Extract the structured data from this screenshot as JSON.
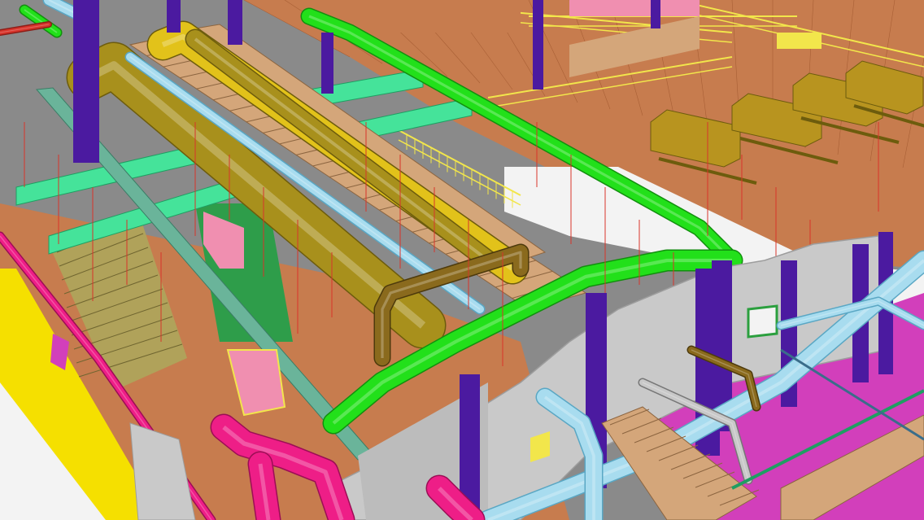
{
  "viewport": {
    "kind": "3d-bim-model-view",
    "text": ""
  },
  "colors": {
    "background_wall": "#8a8a8a",
    "floor_slab": "#c77c4e",
    "floor_slab_dark": "#a85f35",
    "concrete_wall": "#c9c9c9",
    "concrete_wall_edge": "#9d9d9d",
    "white_opening": "#f3f3f3",
    "column_purple": "#4b1aa0",
    "duct_olive": "#a8901c",
    "duct_olive_dark": "#6d5c0d",
    "duct_yellow": "#e2c21a",
    "pipe_green": "#22e01a",
    "pipe_green_dark": "#128f0e",
    "pipe_light_blue": "#a8dcef",
    "pipe_light_blue_dark": "#5aa7c4",
    "pipe_magenta": "#ee1e87",
    "pipe_magenta_dark": "#9b0e55",
    "pipe_brown": "#8a6a1d",
    "tray_mint": "#45e39a",
    "tray_mint_dark": "#1f9e62",
    "cable_tray_tan": "#d4a67a",
    "railing_yellow": "#f2e64b",
    "floor_magenta": "#d23fbb",
    "floor_yellow_edge": "#f5e000",
    "equipment_olive": "#b8941f",
    "hanger_red": "#d8342b",
    "opening_green": "#2e9d4a",
    "pink_equipment": "#f08fb0"
  }
}
